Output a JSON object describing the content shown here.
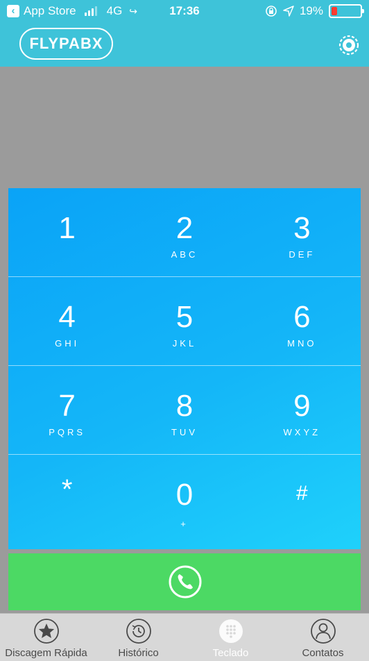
{
  "status_bar": {
    "back_app": "App Store",
    "network": "4G",
    "time": "17:36",
    "battery": "19%"
  },
  "header": {
    "logo": "FLYPABX",
    "settings_icon": "gear-icon"
  },
  "keypad": {
    "rows": [
      [
        {
          "digit": "1",
          "letters": ""
        },
        {
          "digit": "2",
          "letters": "ABC"
        },
        {
          "digit": "3",
          "letters": "DEF"
        }
      ],
      [
        {
          "digit": "4",
          "letters": "GHI"
        },
        {
          "digit": "5",
          "letters": "JKL"
        },
        {
          "digit": "6",
          "letters": "MNO"
        }
      ],
      [
        {
          "digit": "7",
          "letters": "PQRS"
        },
        {
          "digit": "8",
          "letters": "TUV"
        },
        {
          "digit": "9",
          "letters": "WXYZ"
        }
      ],
      [
        {
          "digit": "*",
          "letters": ""
        },
        {
          "digit": "0",
          "letters": "+"
        },
        {
          "digit": "#",
          "letters": ""
        }
      ]
    ]
  },
  "call_button": {
    "icon": "phone-icon"
  },
  "tabs": [
    {
      "label": "Discagem Rápida",
      "icon": "star-icon",
      "active": false
    },
    {
      "label": "Histórico",
      "icon": "history-icon",
      "active": false
    },
    {
      "label": "Teclado",
      "icon": "keypad-icon",
      "active": true
    },
    {
      "label": "Contatos",
      "icon": "contact-icon",
      "active": false
    }
  ],
  "colors": {
    "header": "#3ec3d9",
    "keypad_start": "#0aa3f7",
    "keypad_end": "#1fd1fb",
    "call": "#4cd964",
    "display": "#9b9b9b",
    "tabbar": "#d8d8d8"
  }
}
